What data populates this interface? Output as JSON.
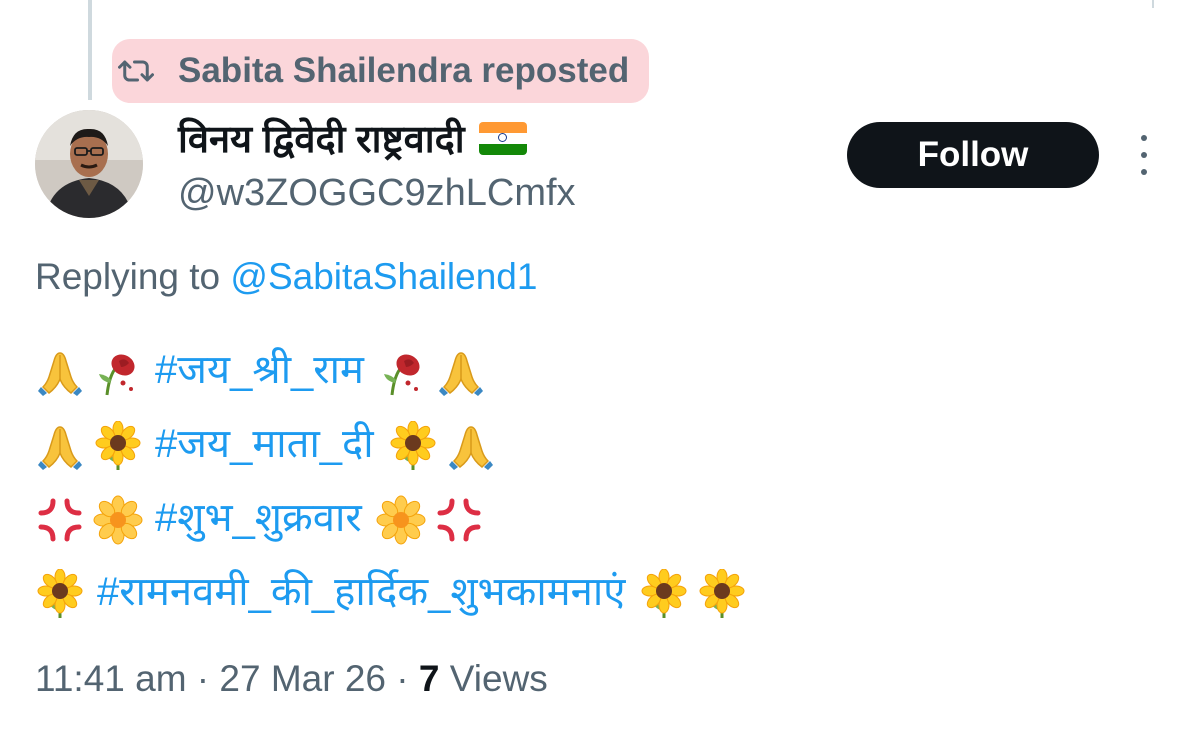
{
  "repost": {
    "text": "Sabita Shailendra reposted",
    "icon": "repost-icon",
    "highlight_color": "#fbd6da"
  },
  "author": {
    "display_name": "विनय द्विवेदी राष्ट्रवादी",
    "flag_icon": "india-flag-icon",
    "handle": "@w3ZOGGC9zhLCmfx",
    "avatar_icon": "avatar"
  },
  "follow_button": {
    "label": "Follow"
  },
  "more_icon": "more-vertical-icon",
  "reply": {
    "prefix": "Replying to ",
    "mention": "@SabitaShailend1"
  },
  "tweet_lines": [
    {
      "tag": "#जय_श्री_राम",
      "emoji_left": [
        "folded-hands",
        "wilted-rose"
      ],
      "emoji_right": [
        "wilted-rose",
        "folded-hands"
      ]
    },
    {
      "tag": "#जय_माता_दी",
      "emoji_left": [
        "folded-hands",
        "sunflower"
      ],
      "emoji_right": [
        "sunflower",
        "folded-hands"
      ]
    },
    {
      "tag": "#शुभ_शुक्रवार",
      "emoji_left": [
        "anger-symbol",
        "blossom"
      ],
      "emoji_right": [
        "blossom",
        "anger-symbol"
      ]
    },
    {
      "tag": "#रामनवमी_की_हार्दिक_शुभकामनाएं",
      "emoji_left": [
        "sunflower"
      ],
      "emoji_right": [
        "sunflower",
        "sunflower"
      ]
    }
  ],
  "meta": {
    "time": "11:41 am",
    "separator": " · ",
    "date": "27 Mar 26",
    "views_count": "7",
    "views_label": " Views"
  },
  "colors": {
    "link": "#1d9bf0",
    "secondary_text": "#536471",
    "primary_text": "#0f1419"
  }
}
